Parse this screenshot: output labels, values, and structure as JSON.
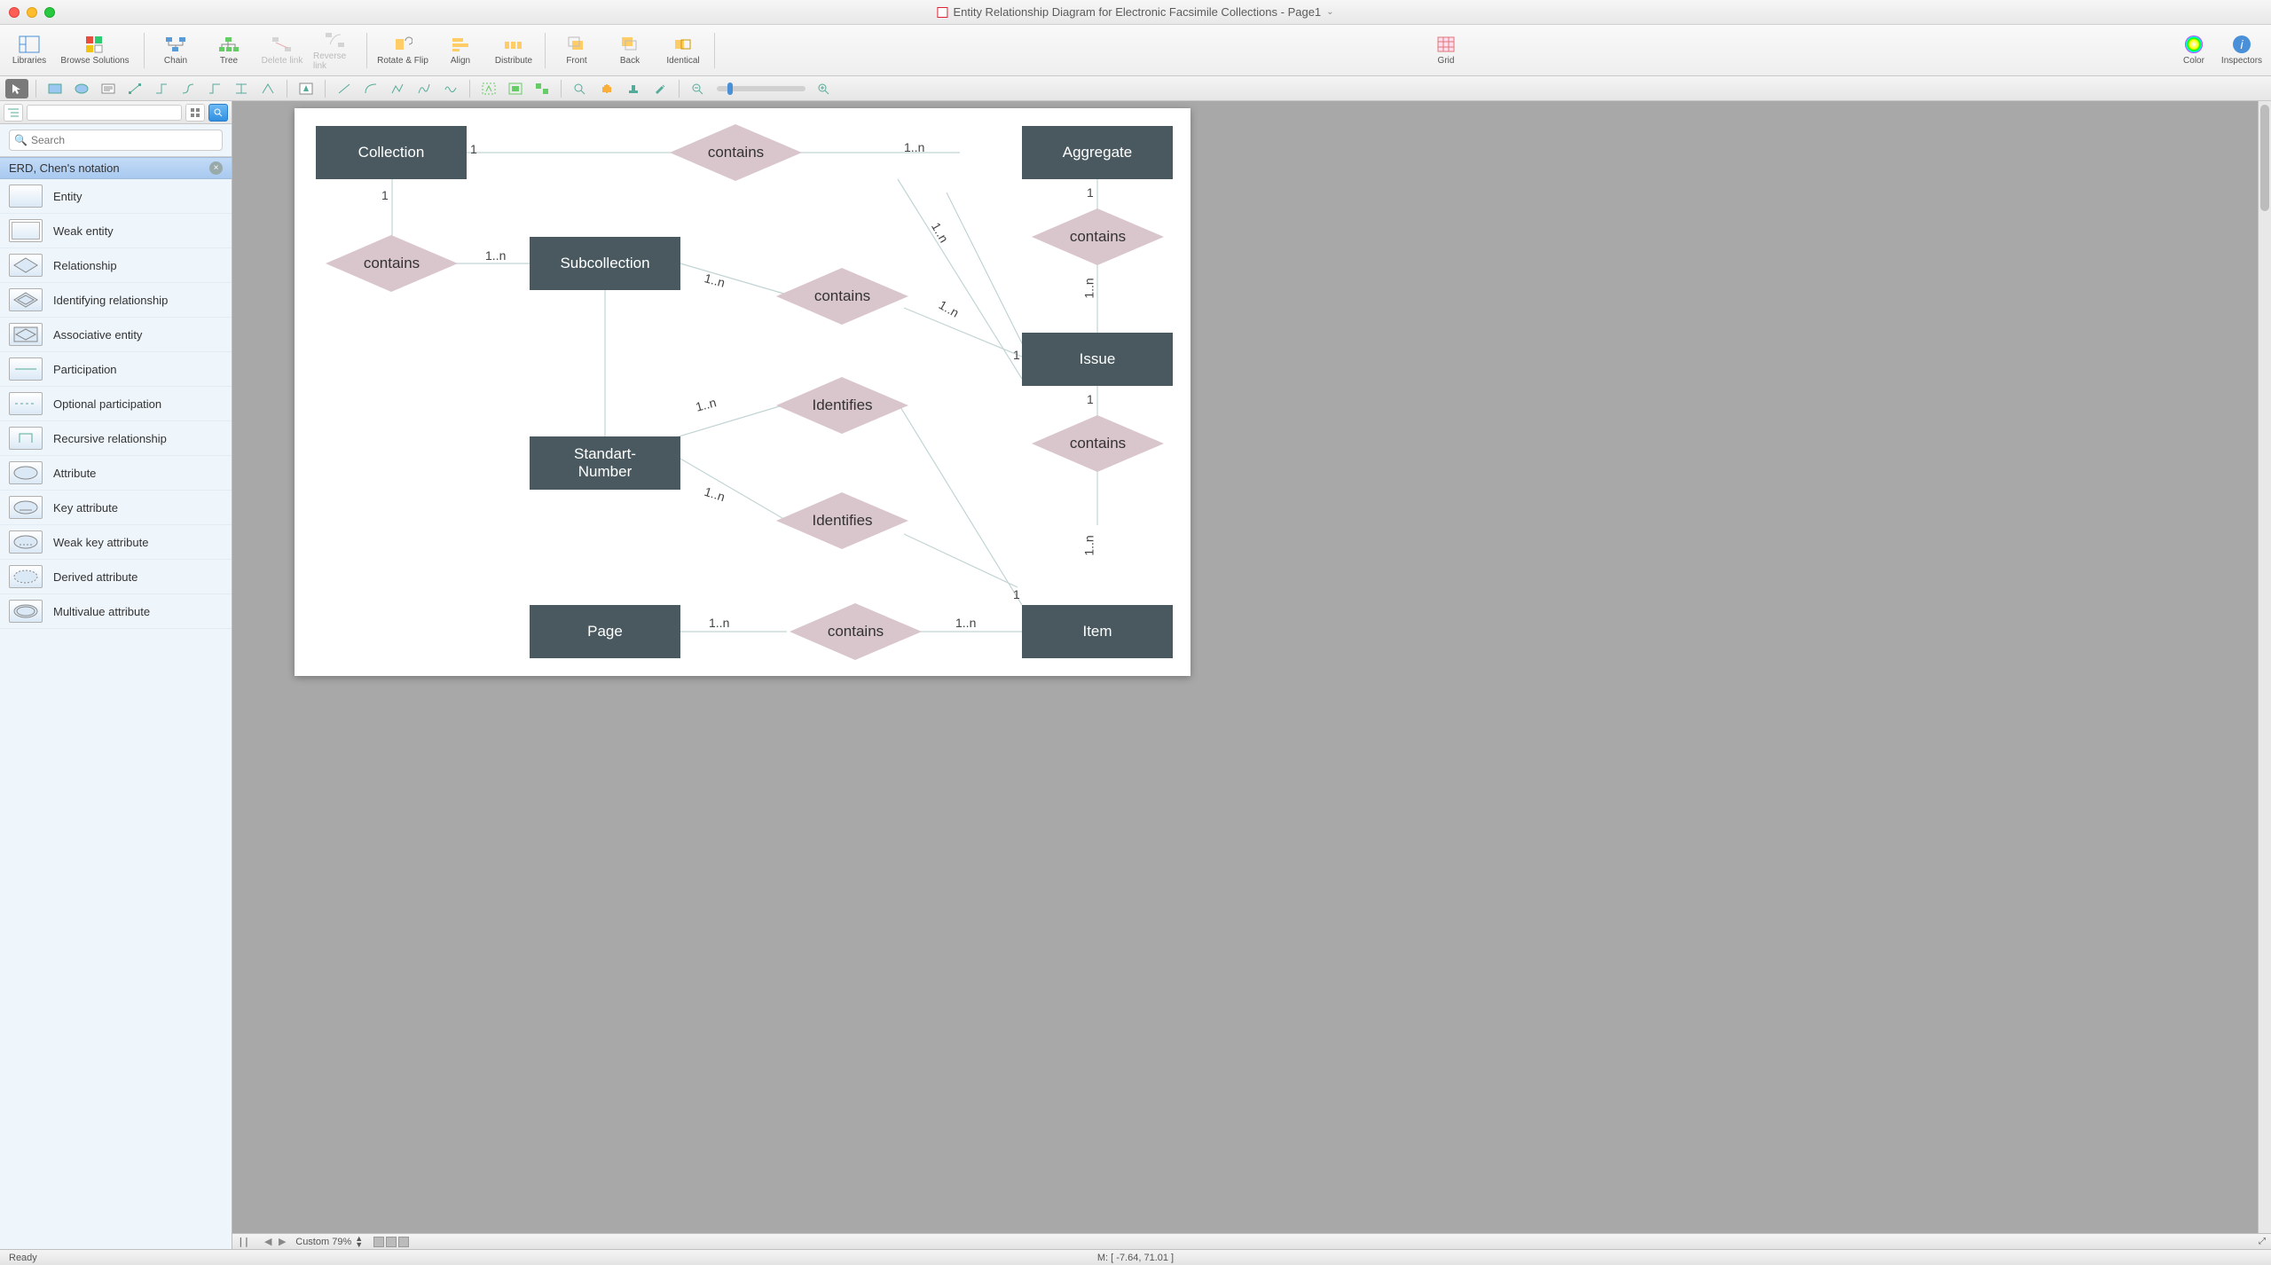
{
  "window": {
    "title": "Entity Relationship Diagram for Electronic Facsimile Collections - Page1"
  },
  "toolbar": {
    "libraries": "Libraries",
    "browse": "Browse Solutions",
    "chain": "Chain",
    "tree": "Tree",
    "delete_link": "Delete link",
    "reverse_link": "Reverse link",
    "rotate": "Rotate & Flip",
    "align": "Align",
    "distribute": "Distribute",
    "front": "Front",
    "back": "Back",
    "identical": "Identical",
    "grid": "Grid",
    "color": "Color",
    "inspectors": "Inspectors"
  },
  "sidebar": {
    "search_placeholder": "Search",
    "library_title": "ERD, Chen's notation",
    "items": [
      {
        "label": "Entity"
      },
      {
        "label": "Weak entity"
      },
      {
        "label": "Relationship"
      },
      {
        "label": "Identifying relationship"
      },
      {
        "label": "Associative entity"
      },
      {
        "label": "Participation"
      },
      {
        "label": "Optional participation"
      },
      {
        "label": "Recursive relationship"
      },
      {
        "label": "Attribute"
      },
      {
        "label": "Key attribute"
      },
      {
        "label": "Weak key attribute"
      },
      {
        "label": "Derived attribute"
      },
      {
        "label": "Multivalue attribute"
      }
    ]
  },
  "diagram": {
    "entities": {
      "collection": "Collection",
      "aggregate": "Aggregate",
      "subcollection": "Subcollection",
      "issue": "Issue",
      "standard_number": "Standart-\nNumber",
      "page": "Page",
      "item": "Item"
    },
    "relations": {
      "contains": "contains",
      "identifies": "Identifies"
    },
    "card": {
      "one": "1",
      "many": "1..n"
    }
  },
  "pagebar": {
    "zoom_label": "Custom 79%"
  },
  "statusbar": {
    "ready": "Ready",
    "mouse": "M: [ -7.64, 71.01 ]"
  }
}
